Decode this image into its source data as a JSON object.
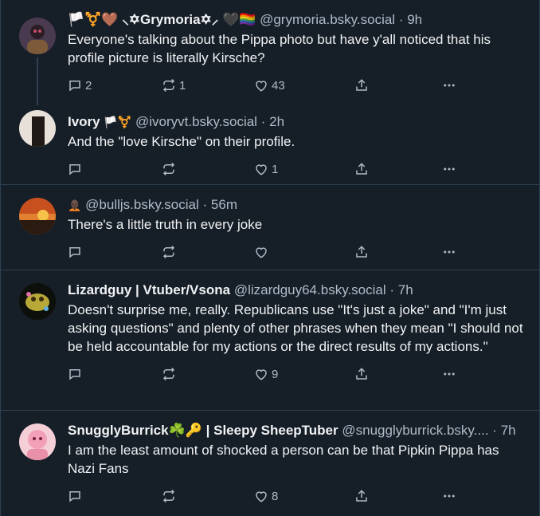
{
  "posts": [
    {
      "name": "🏳️⚧️🤎 ⸜✡︎Grymoria✡︎⸝ 🖤🏳️‍🌈",
      "handle": "@grymoria.bsky.social",
      "time": "9h",
      "text": "Everyone's talking about the Pippa photo but have y'all noticed that his profile picture is literally Kirsche?",
      "replies": "2",
      "reposts": "1",
      "likes": "43",
      "avatar_color": "#4a3a4f"
    },
    {
      "name": "Ivory",
      "badges": "🏳️⚧️",
      "handle": "@ivoryvt.bsky.social",
      "time": "2h",
      "text": "And the \"love Kirsche\" on their profile.",
      "replies": "",
      "reposts": "",
      "likes": "1",
      "avatar_color": "#e8e1d9"
    },
    {
      "name": "",
      "badges": "🧑🏿‍🦲",
      "handle": "@bulljs.bsky.social",
      "time": "56m",
      "text": "There's a little truth in every joke",
      "replies": "",
      "reposts": "",
      "likes": "",
      "avatar_color": "#b5532a"
    },
    {
      "name": "Lizardguy | Vtuber/Vsona",
      "handle": "@lizardguy64.bsky.social",
      "time": "7h",
      "text": "Doesn't surprise me, really. Republicans use \"It's just a joke\" and \"I'm just asking questions\" and plenty of other phrases when they mean \"I should not be held accountable for my actions or the direct results of my actions.\"",
      "replies": "",
      "reposts": "",
      "likes": "9",
      "avatar_color": "#1c2410"
    },
    {
      "name": "SnugglyBurrick☘️🔑 | Sleepy SheepTuber",
      "handle": "@snugglyburrick.bsky....",
      "time": "7h",
      "text": "I am the least amount of shocked a person can be that Pipkin Pippa has Nazi Fans",
      "replies": "",
      "reposts": "",
      "likes": "8",
      "avatar_color": "#f2b3c4"
    }
  ],
  "sep": "·",
  "icons": [
    "reply-icon",
    "repost-icon",
    "like-icon",
    "share-icon",
    "more-icon"
  ]
}
